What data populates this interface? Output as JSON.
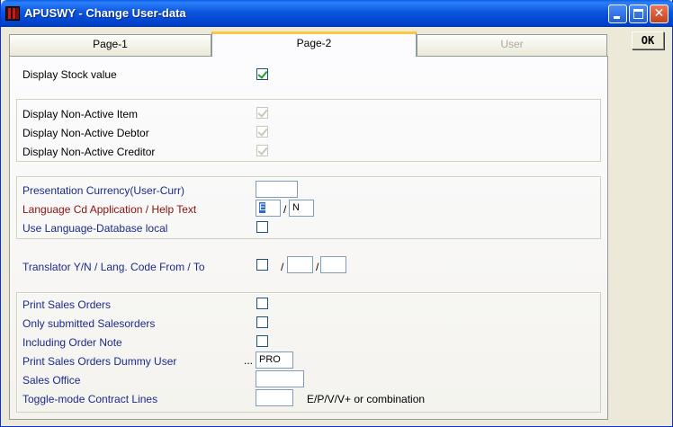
{
  "window": {
    "title": "APUSWY - Change User-data"
  },
  "toolbar": {
    "ok_label": "OK"
  },
  "tabs": [
    {
      "label": "Page-1",
      "state": "normal"
    },
    {
      "label": "Page-2",
      "state": "active"
    },
    {
      "label": "User",
      "state": "disabled"
    }
  ],
  "form": {
    "display_stock_value": {
      "label": "Display Stock value",
      "checked": true
    },
    "non_active": [
      {
        "label": "Display Non-Active Item",
        "checked": true,
        "enabled": false
      },
      {
        "label": "Display Non-Active Debtor",
        "checked": true,
        "enabled": false
      },
      {
        "label": "Display Non-Active Creditor",
        "checked": true,
        "enabled": false
      }
    ],
    "presentation_currency": {
      "label": "Presentation Currency(User-Curr)",
      "value": ""
    },
    "language_cd": {
      "label": "Language Cd Application / Help Text",
      "app_value": "E",
      "separator": "/",
      "help_value": "N"
    },
    "language_db_local": {
      "label": "Use Language-Database local",
      "checked": false
    },
    "translator": {
      "label": "Translator Y/N  /  Lang. Code From / To",
      "checked": false,
      "sep1": "/",
      "from": "",
      "sep2": "/",
      "to": ""
    },
    "print_sales_orders": {
      "label": "Print Sales Orders",
      "checked": false
    },
    "only_submitted": {
      "label": "Only submitted Salesorders",
      "checked": false
    },
    "including_order_note": {
      "label": "Including Order Note",
      "checked": false
    },
    "dummy_user": {
      "label": "Print Sales Orders Dummy User",
      "prefix": "...",
      "value": "PRO"
    },
    "sales_office": {
      "label": "Sales Office",
      "value": ""
    },
    "toggle_mode": {
      "label": "Toggle-mode Contract Lines",
      "value": "",
      "hint": "E/P/V/V+ or combination"
    }
  },
  "colors": {
    "title_bar": "#0a55e0",
    "label_blue": "#1a2a8a",
    "label_red": "#8a1010",
    "check_green": "#21a121",
    "active_tab_accent": "#ffc83c"
  }
}
